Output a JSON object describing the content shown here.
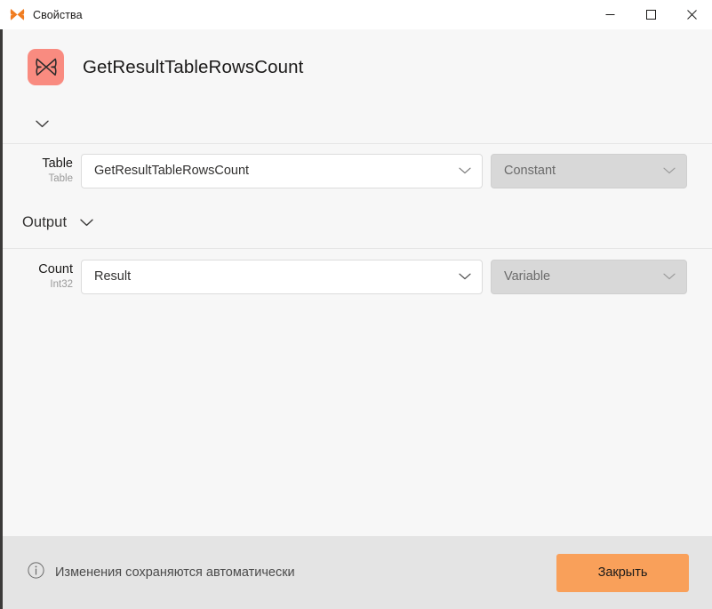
{
  "titlebar": {
    "icon": "butterfly-icon",
    "title": "Свойства",
    "minimize_label": "minimize-icon",
    "maximize_label": "maximize-icon",
    "close_label": "close-icon"
  },
  "header": {
    "badge_icon": "butterfly-icon",
    "badge_color": "#f98b80",
    "activity_name": "GetResultTableRowsCount"
  },
  "collapse": {
    "icon": "chevron-down-icon"
  },
  "sections": {
    "input": {
      "fields": [
        {
          "name": "Table",
          "type": "Table",
          "value": "GetResultTableRowsCount",
          "kind": "Constant",
          "kind_disabled": true
        }
      ]
    },
    "output": {
      "label": "Output",
      "icon": "chevron-down-icon",
      "fields": [
        {
          "name": "Count",
          "type": "Int32",
          "value": "Result",
          "kind": "Variable",
          "kind_disabled": true
        }
      ]
    }
  },
  "footer": {
    "info_icon": "info-circle-icon",
    "note": "Изменения сохраняются автоматически",
    "close_label": "Закрыть",
    "close_color": "#f9a05a"
  }
}
